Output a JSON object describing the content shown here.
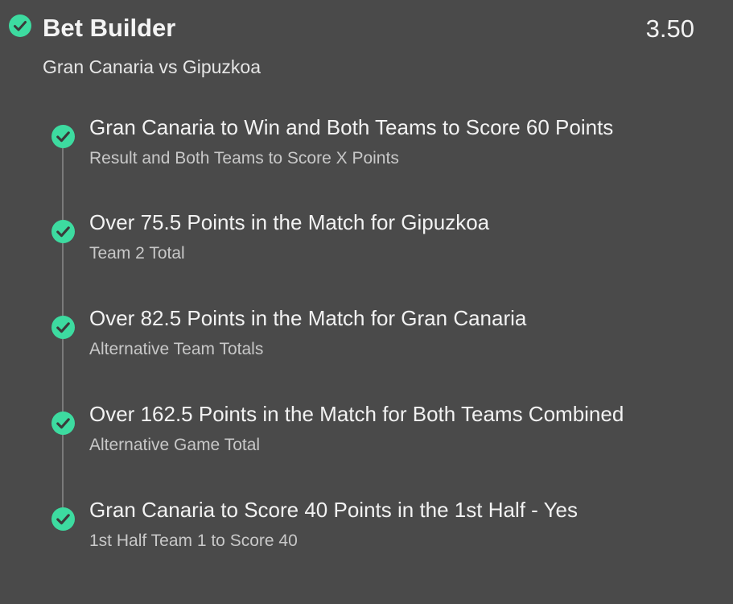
{
  "bet": {
    "title": "Bet Builder",
    "odds": "3.50",
    "match": "Gran Canaria vs Gipuzkoa",
    "status_icon": "check-circle-icon"
  },
  "legs": [
    {
      "title": "Gran Canaria to Win and Both Teams to Score 60 Points",
      "subtitle": "Result and Both Teams to Score X Points",
      "status": "won"
    },
    {
      "title": "Over 75.5 Points in the Match for Gipuzkoa",
      "subtitle": "Team 2 Total",
      "status": "won"
    },
    {
      "title": "Over 82.5 Points in the Match for Gran Canaria",
      "subtitle": "Alternative Team Totals",
      "status": "won"
    },
    {
      "title": "Over 162.5 Points in the Match for Both Teams Combined",
      "subtitle": "Alternative Game Total",
      "status": "won"
    },
    {
      "title": "Gran Canaria to Score 40 Points in the 1st Half - Yes",
      "subtitle": "1st Half Team 1 to Score 40",
      "status": "won"
    }
  ],
  "colors": {
    "background": "#4a4a4a",
    "accent_green": "#3ddba0",
    "check_mark": "#3a3a3a",
    "subtitle_text": "#c8c8c8",
    "timeline": "#7a7a7a"
  }
}
